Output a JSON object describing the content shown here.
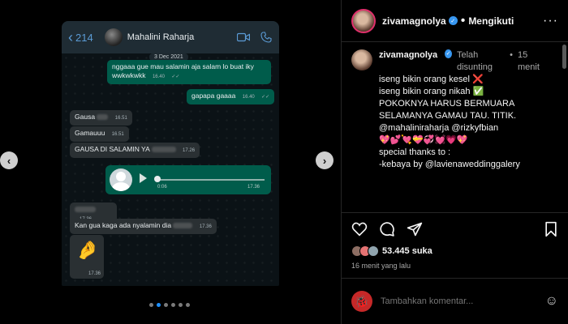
{
  "chat": {
    "back_count": "214",
    "contact_name": "Mahalini Raharja",
    "date_chip": "3 Dec 2021",
    "messages": [
      {
        "text": "nggaaa gue mau salamin aja salam lo buat iky wwkwkwkk",
        "time": "16.40",
        "dir": "out"
      },
      {
        "text": "gapapa gaaaa",
        "time": "16.40",
        "dir": "out"
      },
      {
        "text": "Gausa",
        "time": "16.51",
        "dir": "in"
      },
      {
        "text": "Gamauuu",
        "time": "16.51",
        "dir": "in"
      },
      {
        "text": "GAUSA DI SALAMIN YA",
        "time": "17.26",
        "dir": "in"
      },
      {
        "text": "",
        "time": "17.36",
        "dir": "in"
      },
      {
        "text": "Kan gua kaga ada nyalamin dia",
        "time": "17.36",
        "dir": "in"
      }
    ],
    "voice": {
      "duration": "0:06",
      "time": "17.36"
    },
    "sticker_time": "17.36"
  },
  "carousel": {
    "dots": 6,
    "active": 1
  },
  "post": {
    "username": "zivamagnolya",
    "follow_label": "Mengikuti",
    "caption": {
      "username": "zivamagnolya",
      "edited": "Telah disunting",
      "time": "15 menit",
      "lines": [
        "iseng bikin orang kesel ❌",
        "iseng bikin orang nikah ✅",
        "",
        "POKOKNYA HARUS BERMUARA SELAMANYA GAMAU TAU. TITIK. @mahaliniraharja @rizkyfbian",
        "",
        "💖💕💘💝💞💓💗💖",
        "",
        "special thanks to :",
        "",
        "-kebaya by @lavienaweddinggalery"
      ]
    },
    "likes": "53.445 suka",
    "time_ago": "16 menit yang lalu",
    "comment_placeholder": "Tambahkan komentar..."
  }
}
